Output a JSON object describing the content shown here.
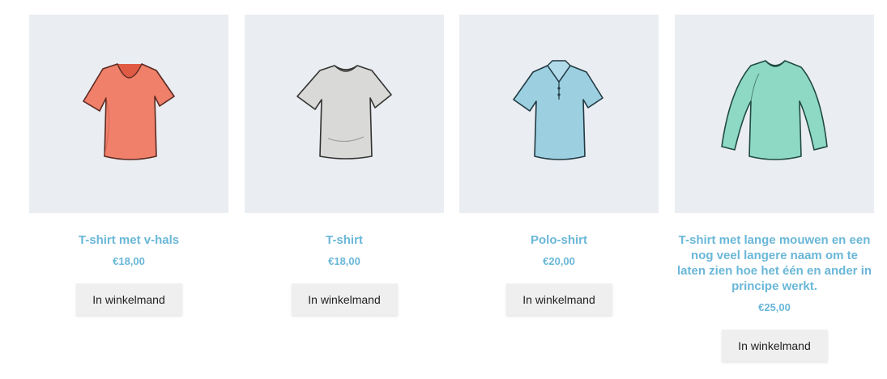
{
  "products": [
    {
      "name": "T-shirt met v-hals",
      "price": "€18,00",
      "button_label": "In winkelmand",
      "image_icon": "vneck-tshirt-icon",
      "color": "#f0806a"
    },
    {
      "name": "T-shirt",
      "price": "€18,00",
      "button_label": "In winkelmand",
      "image_icon": "tshirt-icon",
      "color": "#d9d9d7"
    },
    {
      "name": "Polo-shirt",
      "price": "€20,00",
      "button_label": "In winkelmand",
      "image_icon": "polo-shirt-icon",
      "color": "#9cd0e0"
    },
    {
      "name": "T-shirt met lange mouwen en een nog veel langere naam om te laten zien hoe het één en ander in principe werkt.",
      "price": "€25,00",
      "button_label": "In winkelmand",
      "image_icon": "longsleeve-shirt-icon",
      "color": "#8ed9c4"
    }
  ],
  "colors": {
    "accent": "#6ab7d8",
    "thumb_background": "#eaedf1",
    "button_background": "#efefef"
  }
}
